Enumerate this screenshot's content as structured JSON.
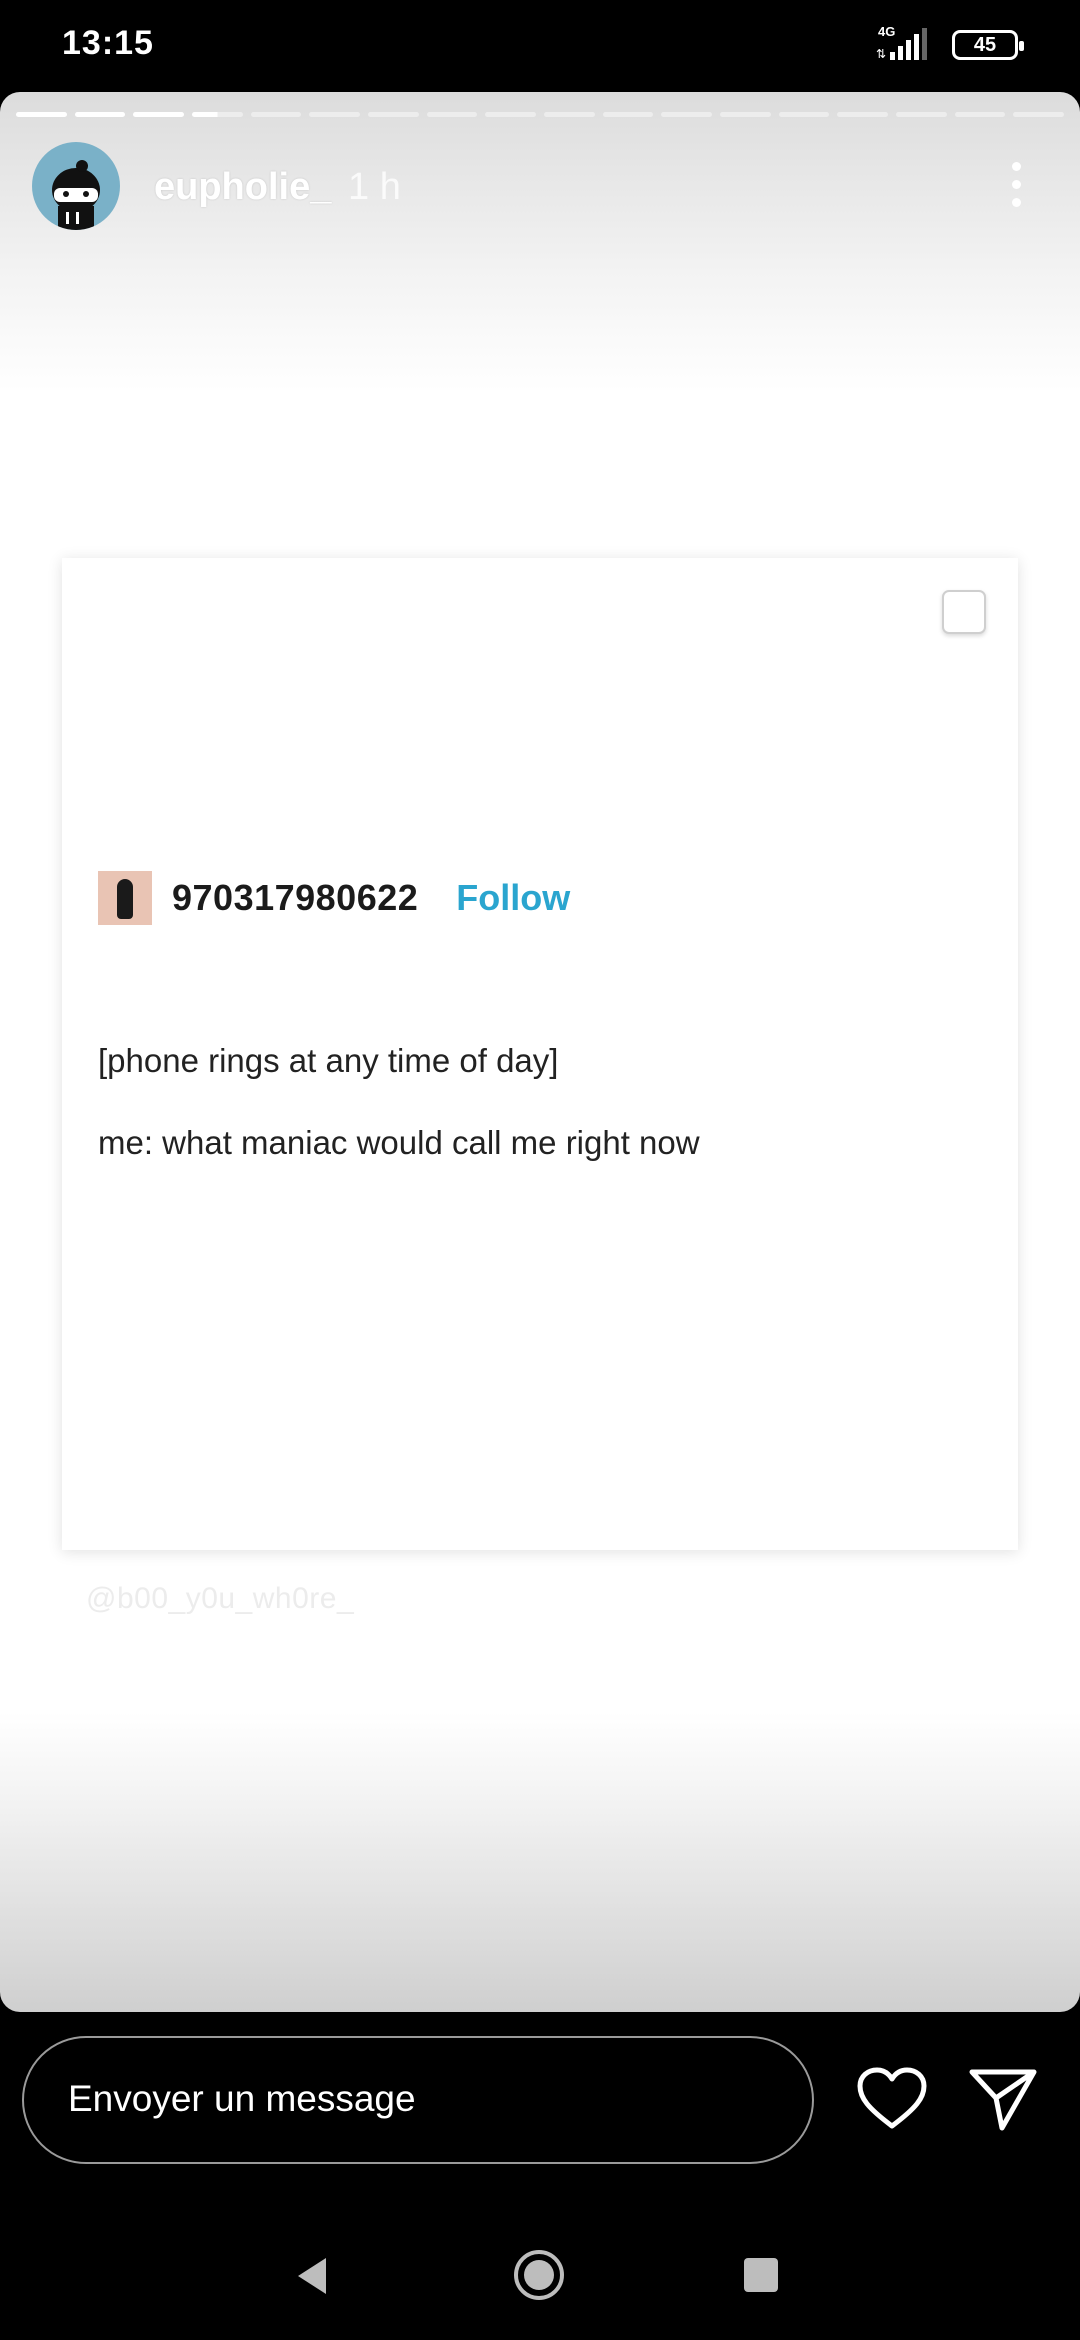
{
  "status_bar": {
    "time": "13:15",
    "network": "4G",
    "battery": "45"
  },
  "story": {
    "progress": {
      "segments": 18,
      "completed": 3,
      "current_partial": 0.5
    },
    "username": "eupholie_",
    "elapsed": "1 h",
    "post": {
      "author": "970317980622",
      "follow_label": "Follow",
      "lines": [
        "[phone rings at any time of day]",
        "me: what maniac would call me right now"
      ]
    },
    "watermark": "@b00_y0u_wh0re_"
  },
  "reply": {
    "placeholder": "Envoyer un message"
  },
  "colors": {
    "follow": "#2aa5cf",
    "avatar_bg": "#7ab1c8"
  }
}
